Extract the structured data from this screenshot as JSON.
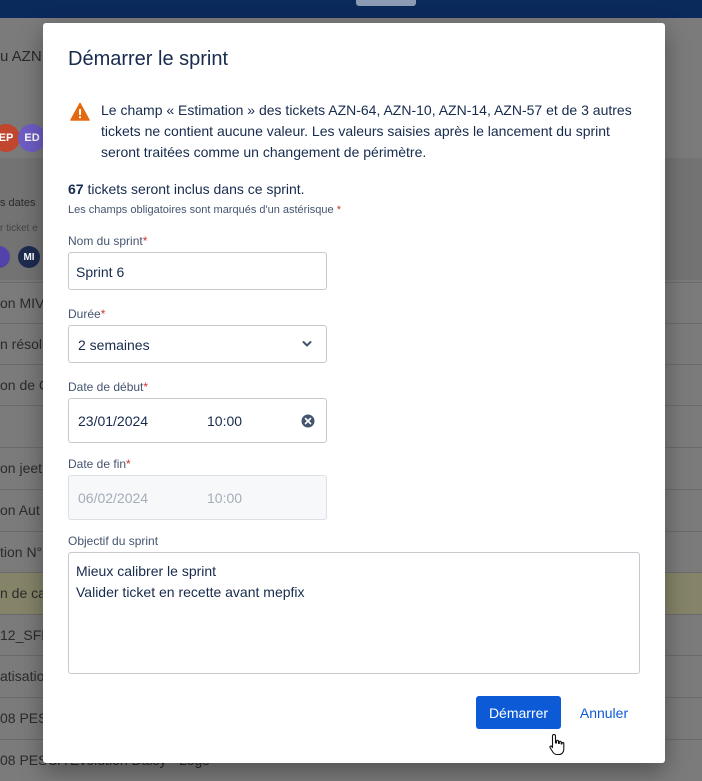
{
  "background": {
    "project_title": "u AZN",
    "avatars": [
      "EP",
      "ED"
    ],
    "avatars_small": [
      "MI"
    ],
    "filter_label": "s dates",
    "filter_sub": "r ticket e",
    "rows": [
      "on MIV",
      "n résolu",
      "on de C",
      "",
      "on jeet",
      "on Aut",
      "tion N°",
      "n de ca",
      "12_SFR",
      "atisatio",
      "08 PES",
      "08 PESCA Evolution Daisy - Logs"
    ]
  },
  "modal": {
    "title": "Démarrer le sprint",
    "warning": "Le champ « Estimation » des tickets AZN-64, AZN-10, AZN-14, AZN-57 et de 3 autres tickets ne contient aucune valeur. Les valeurs saisies après le lancement du sprint seront traitées comme un changement de périmètre.",
    "ticket_count": "67",
    "ticket_count_suffix": " tickets seront inclus dans ce sprint.",
    "required_note": "Les champs obligatoires sont marqués d'un astérisque",
    "required_star": "*",
    "sprint_name": {
      "label": "Nom du sprint",
      "value": "Sprint 6"
    },
    "duration": {
      "label": "Durée",
      "value": "2 semaines"
    },
    "start_date": {
      "label": "Date de début",
      "date": "23/01/2024",
      "time": "10:00"
    },
    "end_date": {
      "label": "Date de fin",
      "date": "06/02/2024",
      "time": "10:00"
    },
    "goal": {
      "label": "Objectif du sprint",
      "lines": [
        "Mieux calibrer le sprint",
        "Valider ticket en recette avant mepfix"
      ]
    },
    "start_button": "Démarrer",
    "cancel_button": "Annuler"
  },
  "colors": {
    "primary": "#0c5ad6",
    "warning": "#e56910",
    "required": "#c9372c",
    "overlay": "#7b7b7b"
  },
  "icons": [
    "warning-icon",
    "chevron-down-icon",
    "clear-icon",
    "hand-cursor-icon"
  ]
}
